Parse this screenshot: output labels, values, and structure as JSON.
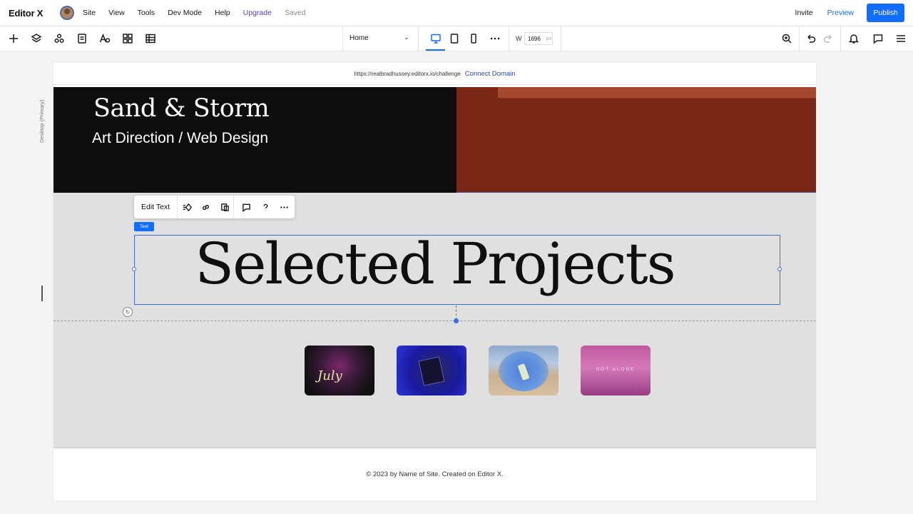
{
  "app": {
    "logo": "Editor X",
    "menu": [
      "Site",
      "View",
      "Tools",
      "Dev Mode",
      "Help",
      "Upgrade",
      "Saved"
    ],
    "invite_label": "Invite",
    "preview_label": "Preview",
    "publish_label": "Publish"
  },
  "toolbar": {
    "left_icons": [
      "add-icon",
      "layers-icon",
      "components-icon",
      "pages-icon",
      "typography-icon",
      "apps-icon",
      "table-icon"
    ],
    "page_select": "Home",
    "devices": [
      "desktop-icon",
      "tablet-icon",
      "mobile-icon",
      "more-icon"
    ],
    "width_label": "W",
    "width_value": "1696",
    "width_unit": "px",
    "right_icons": [
      "zoom-icon",
      "undo-icon",
      "redo-icon",
      "bell-icon",
      "comment-icon",
      "inspector-icon"
    ]
  },
  "canvas": {
    "breakpoint_label": "Desktop (Primary)",
    "url": "https://realbradhussey.editorx.io/challenge",
    "connect_domain": "Connect Domain"
  },
  "site": {
    "hero_title": "Sand & Storm",
    "hero_subtitle": "Art Direction / Web Design",
    "section_title": "Selected Projects",
    "thumbnails": [
      {
        "caption": "July"
      },
      {
        "caption": ""
      },
      {
        "caption": ""
      },
      {
        "caption": "NOT ALONE"
      }
    ],
    "footer": "© 2023 by Name of Site. Created on Editor X."
  },
  "selection": {
    "edit_text_label": "Edit Text",
    "tag_label": "Text",
    "context_icons": [
      "animation-icon",
      "link-icon",
      "duplicate-icon",
      "comment-icon",
      "help-icon",
      "more-icon"
    ]
  },
  "colors": {
    "accent": "#116dff",
    "upgrade": "#5b3bd3",
    "hero_dark": "#0e0e0e",
    "hero_rust": "#7a2716",
    "section_bg": "#e0e0e0"
  }
}
